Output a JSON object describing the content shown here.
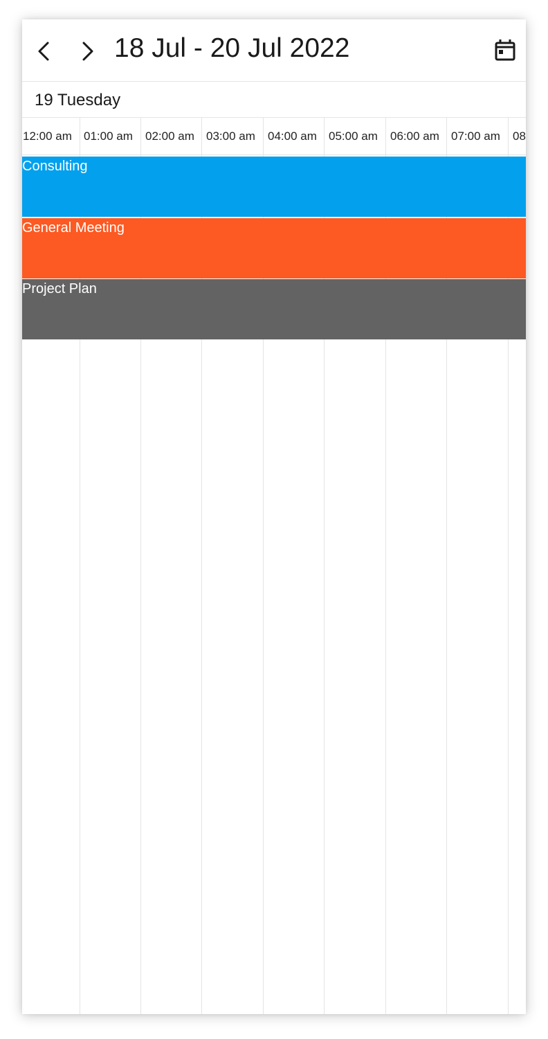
{
  "header": {
    "prev_icon": "chevron-left-icon",
    "next_icon": "chevron-right-icon",
    "title": "18 Jul - 20 Jul 2022",
    "today_icon": "calendar-today-icon"
  },
  "day_header": {
    "label": "19 Tuesday"
  },
  "timeline": {
    "slots": [
      "12:00 am",
      "01:00 am",
      "02:00 am",
      "03:00 am",
      "04:00 am",
      "05:00 am",
      "06:00 am",
      "07:00 am",
      "08"
    ]
  },
  "appointments": [
    {
      "title": "Consulting",
      "color": "#03a0ed"
    },
    {
      "title": "General Meeting",
      "color": "#fd5922"
    },
    {
      "title": "Project Plan",
      "color": "#636363"
    }
  ]
}
